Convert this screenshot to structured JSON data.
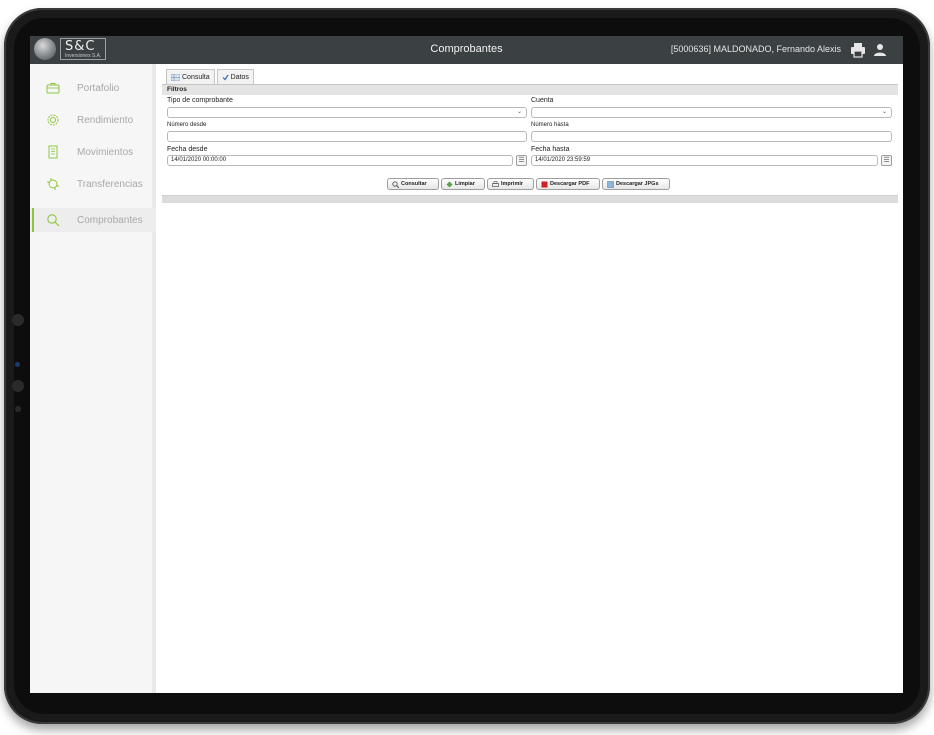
{
  "header": {
    "logo_text": "S&C",
    "logo_sub": "Inversiones S.A.",
    "title": "Comprobantes",
    "user": "[5000636] MALDONADO, Fernando Alexis"
  },
  "sidebar": {
    "items": [
      {
        "label": "Portafolio",
        "icon": "briefcase-icon",
        "active": false
      },
      {
        "label": "Rendimiento",
        "icon": "gear-icon",
        "active": false
      },
      {
        "label": "Movimientos",
        "icon": "document-icon",
        "active": false
      },
      {
        "label": "Transferencias",
        "icon": "transfer-icon",
        "active": false
      },
      {
        "label": "Comprobantes",
        "icon": "search-icon",
        "active": true
      }
    ],
    "accent_color": "#8cc63f"
  },
  "tabs": [
    {
      "label": "Consulta",
      "icon": "grid-icon"
    },
    {
      "label": "Datos",
      "icon": "check-icon"
    }
  ],
  "filters": {
    "title": "Filtros",
    "tipo_label": "Tipo de comprobante",
    "tipo_value": "",
    "cuenta_label": "Cuenta",
    "cuenta_value": "",
    "numero_desde_label": "Número desde",
    "numero_desde_value": "",
    "numero_hasta_label": "Número hasta",
    "numero_hasta_value": "",
    "fecha_desde_label": "Fecha desde",
    "fecha_desde_value": "14/01/2020 00:00:00",
    "fecha_hasta_label": "Fecha hasta",
    "fecha_hasta_value": "14/01/2020 23:59:59"
  },
  "buttons": {
    "consultar": "Consultar",
    "limpiar": "Limpiar",
    "imprimir": "Imprimir",
    "descargar_pdf": "Descargar PDF",
    "descargar_jpgs": "Descargar JPGs"
  }
}
